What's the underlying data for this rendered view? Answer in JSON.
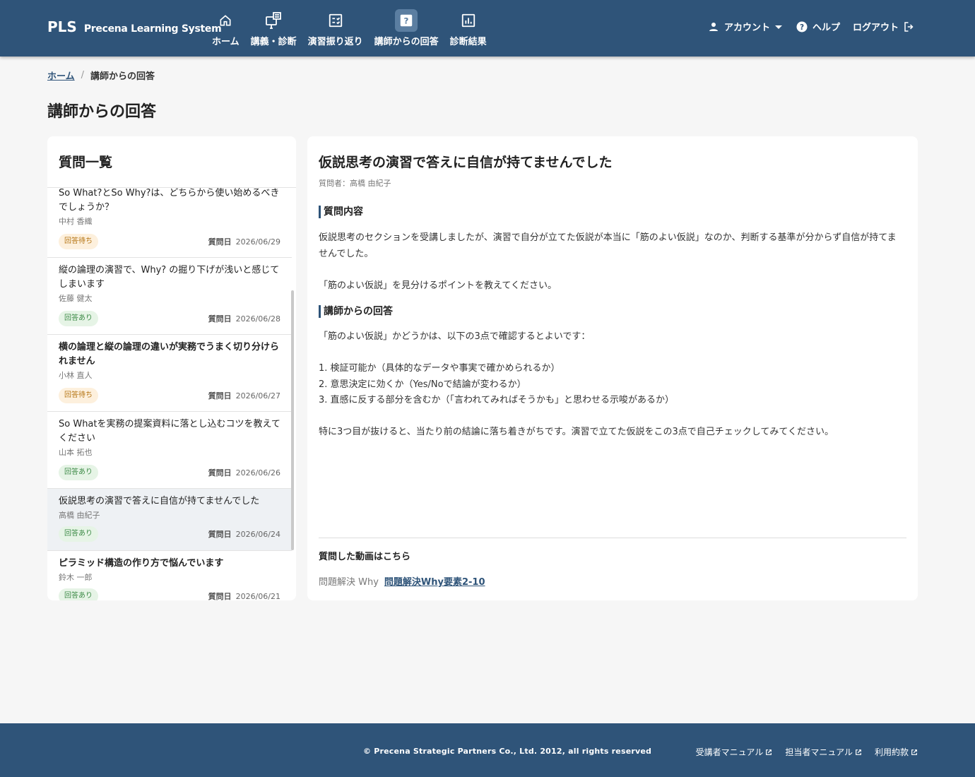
{
  "header": {
    "logo_mark": "PLS",
    "logo_name": "Precena Learning System",
    "nav": [
      {
        "label": "ホーム",
        "icon": "home-icon"
      },
      {
        "label": "講義・診断",
        "icon": "lecture-icon"
      },
      {
        "label": "演習振り返り",
        "icon": "checklist-icon"
      },
      {
        "label": "講師からの回答",
        "icon": "question-icon"
      },
      {
        "label": "診断結果",
        "icon": "bar-chart-icon"
      }
    ],
    "account": "アカウント",
    "help": "ヘルプ",
    "logout": "ログアウト"
  },
  "breadcrumb": {
    "home": "ホーム",
    "separator": "/",
    "current": "講師からの回答"
  },
  "page_title": "講師からの回答",
  "list": {
    "title": "質問一覧",
    "date_label": "質問日",
    "items": [
      {
        "title": "So What?とSo Why?は、どちらから使い始めるべきでしょうか？",
        "author": "中村 香織",
        "status": "回答待ち",
        "date": "2026/06/29"
      },
      {
        "title": "縦の論理の演習で、Why? の掘り下げが浅いと感じてしまいます",
        "author": "佐藤 健太",
        "status": "回答あり",
        "date": "2026/06/28"
      },
      {
        "title": "横の論理と縦の論理の違いが実務でうまく切り分けられません",
        "author": "小林 直人",
        "status": "回答待ち",
        "date": "2026/06/27"
      },
      {
        "title": "So Whatを実務の提案資料に落とし込むコツを教えてください",
        "author": "山本 拓也",
        "status": "回答あり",
        "date": "2026/06/26"
      },
      {
        "title": "仮説思考の演習で答えに自信が持てませんでした",
        "author": "高橋 由紀子",
        "status": "回答あり",
        "date": "2026/06/24"
      },
      {
        "title": "ピラミッド構造の作り方で悩んでいます",
        "author": "鈴木 一郎",
        "status": "回答あり",
        "date": "2026/06/21"
      }
    ]
  },
  "detail": {
    "title": "仮説思考の演習で答えに自信が持てませんでした",
    "asker": "質問者：高橋 由紀子",
    "question_heading": "質問内容",
    "question_body": "仮説思考のセクションを受講しましたが、演習で自分が立てた仮説が本当に「筋のよい仮説」なのか、判断する基準が分からず自信が持てませんでした。\n\n「筋のよい仮説」を見分けるポイントを教えてください。",
    "answer_heading": "講師からの回答",
    "answer_body": "「筋のよい仮説」かどうかは、以下の3点で確認するとよいです：\n\n1. 検証可能か（具体的なデータや事実で確かめられるか）\n2. 意思決定に効くか（Yes/Noで結論が変わるか）\n3. 直感に反する部分を含むか（「言われてみればそうかも」と思わせる示唆があるか）\n\n特に3つ目が抜けると、当たり前の結論に落ち着きがちです。演習で立てた仮説をこの3点で自己チェックしてみてください。",
    "video_heading": "質問した動画はこちら",
    "video_category": "問題解決 Why",
    "video_link": "問題解決Why要素2-10"
  },
  "footer": {
    "copyright": "© Precena Strategic Partners Co., Ltd. 2012, all rights reserved",
    "links": [
      "受講者マニュアル",
      "担当者マニュアル",
      "利用約款"
    ]
  },
  "colors": {
    "brand": "#2f5479",
    "active_nav": "#5b7ea1",
    "badge_wait_bg": "#fdf0dd",
    "badge_done_bg": "#e6f4e6"
  }
}
